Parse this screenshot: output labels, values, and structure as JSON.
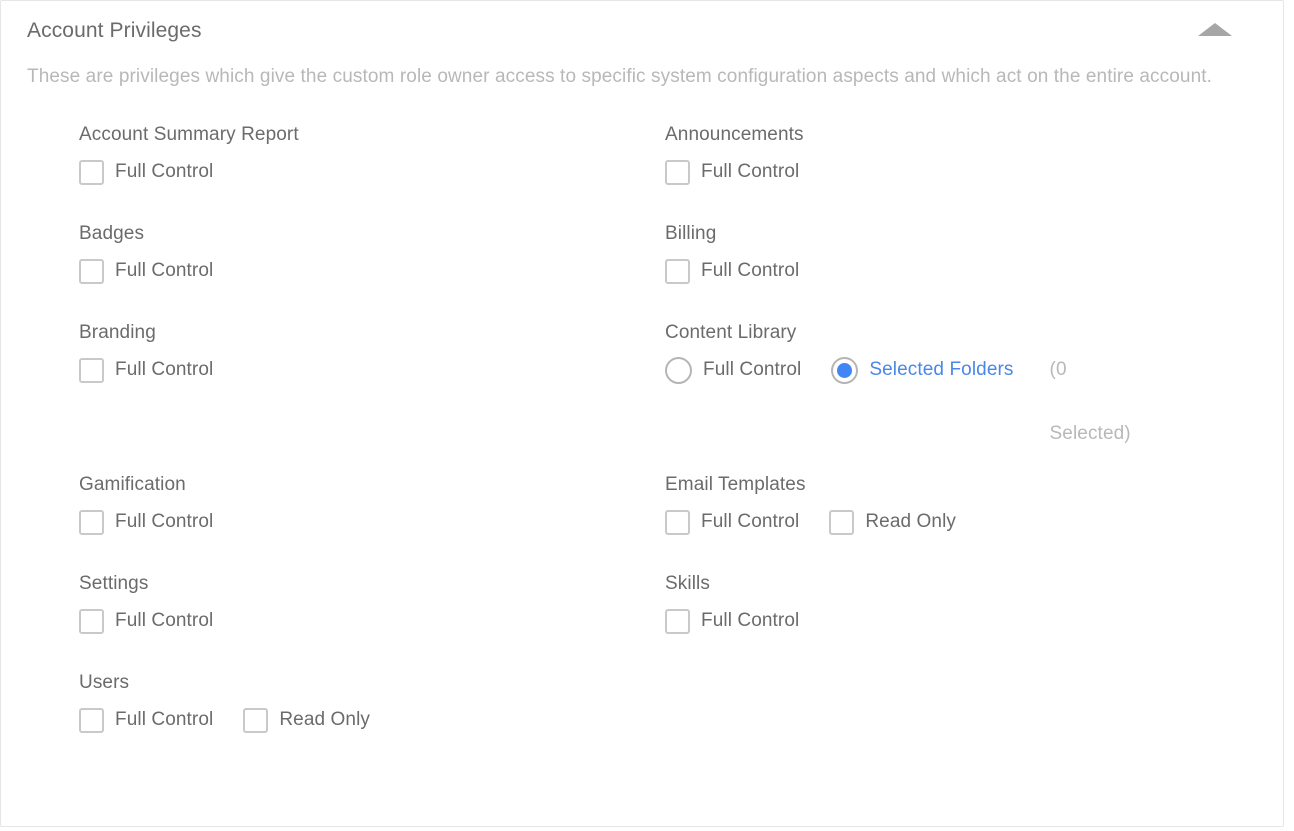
{
  "panel": {
    "title": "Account Privileges",
    "description": "These are privileges which give the custom role owner access to specific system configuration aspects and which act on the entire account.",
    "collapse_icon": "caret-up-icon",
    "accent_color": "#4285f4",
    "label_color": "#6b6b6b",
    "muted_color": "#b8b8b8",
    "border_color": "#e6e6e6",
    "checkbox_border_color": "#c9c9c9",
    "radio_border_color": "#b5b5b5"
  },
  "labels": {
    "full_control": "Full Control",
    "read_only": "Read Only",
    "selected_folders": "Selected Folders",
    "folder_count_open": "(0",
    "folder_count_close": "Selected)"
  },
  "groups": {
    "left": [
      {
        "name": "Account Summary Report",
        "options": [
          {
            "type": "checkbox",
            "label": "Full Control",
            "checked": false
          }
        ]
      },
      {
        "name": "Badges",
        "options": [
          {
            "type": "checkbox",
            "label": "Full Control",
            "checked": false
          }
        ]
      },
      {
        "name": "Branding",
        "options": [
          {
            "type": "checkbox",
            "label": "Full Control",
            "checked": false
          }
        ]
      },
      {
        "name": "Gamification",
        "options": [
          {
            "type": "checkbox",
            "label": "Full Control",
            "checked": false
          }
        ]
      },
      {
        "name": "Settings",
        "options": [
          {
            "type": "checkbox",
            "label": "Full Control",
            "checked": false
          }
        ]
      },
      {
        "name": "Users",
        "options": [
          {
            "type": "checkbox",
            "label": "Full Control",
            "checked": false
          },
          {
            "type": "checkbox",
            "label": "Read Only",
            "checked": false
          }
        ]
      }
    ],
    "right": [
      {
        "name": "Announcements",
        "options": [
          {
            "type": "checkbox",
            "label": "Full Control",
            "checked": false
          }
        ]
      },
      {
        "name": "Billing",
        "options": [
          {
            "type": "checkbox",
            "label": "Full Control",
            "checked": false
          }
        ]
      },
      {
        "name": "Content Library",
        "options": [
          {
            "type": "radio",
            "label": "Full Control",
            "checked": false
          },
          {
            "type": "radio",
            "label": "Selected Folders",
            "checked": true,
            "accent": true,
            "counter": "(0",
            "counter_tail": "Selected)"
          }
        ]
      },
      {
        "name": "Email Templates",
        "options": [
          {
            "type": "checkbox",
            "label": "Full Control",
            "checked": false
          },
          {
            "type": "checkbox",
            "label": "Read Only",
            "checked": false
          }
        ]
      },
      {
        "name": "Skills",
        "options": [
          {
            "type": "checkbox",
            "label": "Full Control",
            "checked": false
          }
        ]
      }
    ]
  }
}
